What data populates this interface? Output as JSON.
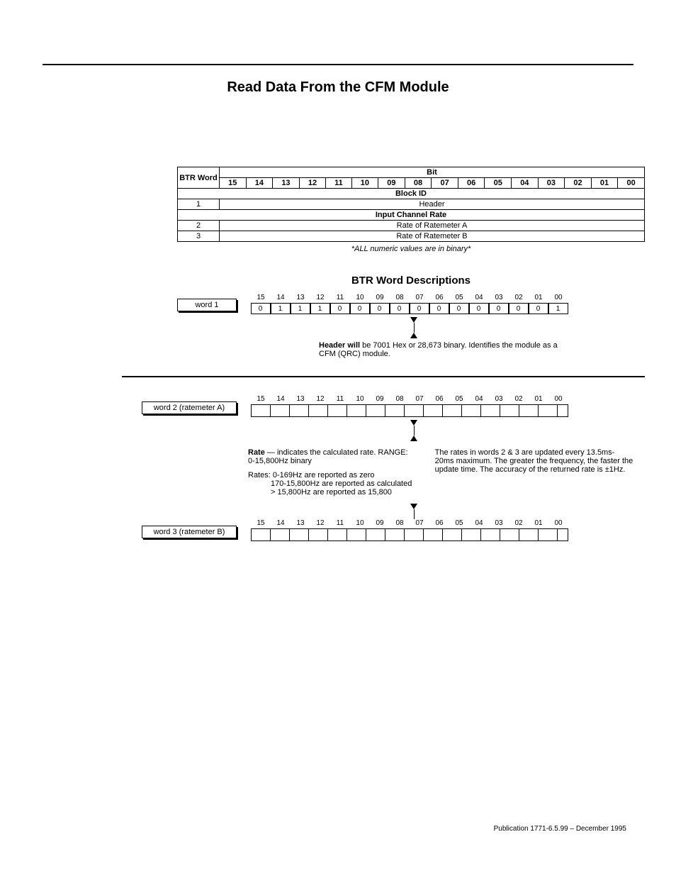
{
  "title": "Read Data From the CFM Module",
  "table": {
    "rowHeader": "BTR Word",
    "bitHeader": "Bit",
    "bits": [
      "15",
      "14",
      "13",
      "12",
      "11",
      "10",
      "09",
      "08",
      "07",
      "06",
      "05",
      "04",
      "03",
      "02",
      "01",
      "00"
    ],
    "sections": [
      {
        "name": "Block ID",
        "rows": [
          {
            "num": "1",
            "desc": "Header"
          }
        ]
      },
      {
        "name": "Input Channel Rate",
        "rows": [
          {
            "num": "2",
            "desc": "Rate of Ratemeter A"
          },
          {
            "num": "3",
            "desc": "Rate of Ratemeter B"
          }
        ]
      }
    ],
    "footnote": "*ALL numeric values are in binary*"
  },
  "subhead": "BTR Word Descriptions",
  "word1": {
    "label": "word 1",
    "bits": [
      "0",
      "1",
      "1",
      "1",
      "0",
      "0",
      "0",
      "0",
      "0",
      "0",
      "0",
      "0",
      "0",
      "0",
      "0",
      "1"
    ],
    "idx": [
      "15",
      "14",
      "13",
      "12",
      "11",
      "10",
      "09",
      "08",
      "07",
      "06",
      "05",
      "04",
      "03",
      "02",
      "01",
      "00"
    ],
    "note_lead": "Header will",
    "note_rest": " be 7001 Hex or 28,673 binary.  Identifies the module as a CFM (QRC) module."
  },
  "word2": {
    "label": "word 2 (ratemeter A)",
    "idx": [
      "15",
      "14",
      "13",
      "12",
      "11",
      "10",
      "09",
      "08",
      "07",
      "06",
      "05",
      "04",
      "03",
      "02",
      "01",
      "00"
    ],
    "rate_lead": "Rate",
    "rate_rest": " — indicates the calculated rate. RANGE: 0-15,800Hz binary",
    "rates_note1": "Rates: 0-169Hz are reported as zero",
    "rates_note2": "170-15,800Hz are reported as calculated",
    "rates_note3": "> 15,800Hz are reported as 15,800",
    "side_note": "The rates in words 2 & 3 are updated every 13.5ms-20ms maximum.  The greater the frequency, the faster the update time.  The accuracy of the returned rate is ±1Hz."
  },
  "word3": {
    "label": "word 3 (ratemeter B)",
    "idx": [
      "15",
      "14",
      "13",
      "12",
      "11",
      "10",
      "09",
      "08",
      "07",
      "06",
      "05",
      "04",
      "03",
      "02",
      "01",
      "00"
    ]
  },
  "pub": "Publication 1771-6.5.99 – December 1995"
}
